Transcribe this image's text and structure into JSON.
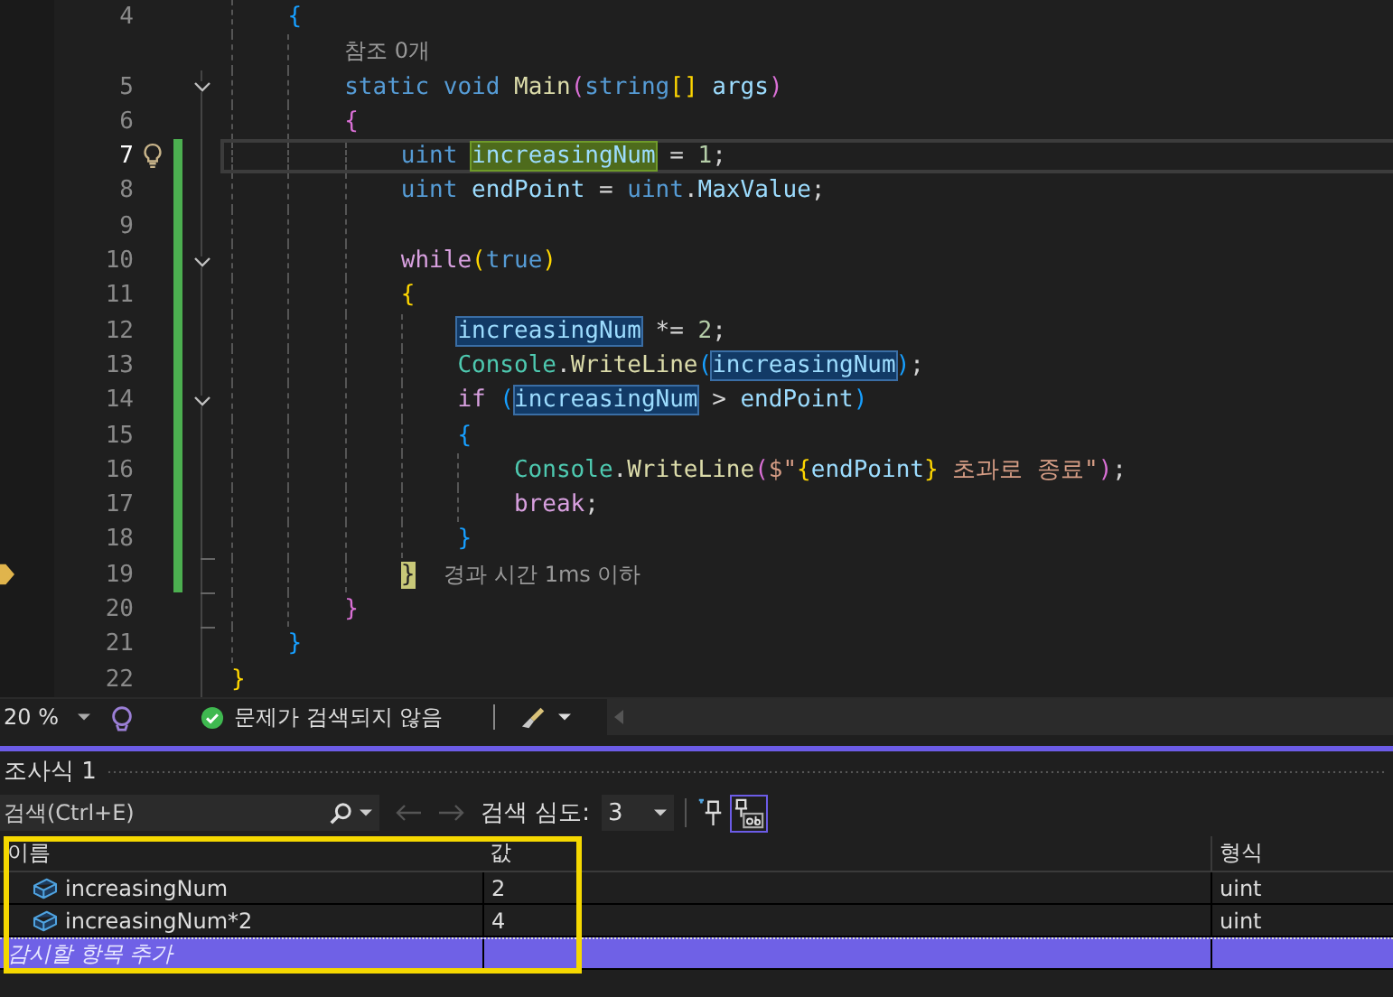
{
  "editor": {
    "lines": [
      {
        "children": [
          {
            "number": "4",
            "selected": false,
            "changed": false,
            "tokens": [
              {
                "text": "{",
                "kind": "brace3"
              }
            ],
            "children": [
              {
                "kind": "lens",
                "text": "참조 0개"
              },
              {
                "number": "5",
                "selected": false,
                "changed": false,
                "collapsible": true,
                "tokens": [
                  {
                    "text": "static ",
                    "kind": "keyword"
                  },
                  {
                    "text": "void ",
                    "kind": "keyword"
                  },
                  {
                    "text": "Main",
                    "kind": "method"
                  },
                  {
                    "text": "(",
                    "kind": "brace2"
                  },
                  {
                    "text": "string",
                    "kind": "keyword"
                  },
                  {
                    "text": "[] ",
                    "kind": "brace1"
                  },
                  {
                    "text": "args",
                    "kind": "variable"
                  },
                  {
                    "text": ")",
                    "kind": "brace2"
                  }
                ]
              },
              {
                "number": "6",
                "selected": false,
                "changed": false,
                "tokens": [
                  {
                    "text": "{",
                    "kind": "brace2"
                  }
                ],
                "children": [
                  {
                    "number": "7",
                    "selected": true,
                    "changed": true,
                    "bulb": true,
                    "tokens": [
                      {
                        "text": "uint ",
                        "kind": "keyword"
                      },
                      {
                        "text": "increasingNum",
                        "kind": "written"
                      },
                      {
                        "text": " = ",
                        "kind": "punct"
                      },
                      {
                        "text": "1",
                        "kind": "number"
                      },
                      {
                        "text": ";",
                        "kind": "punct"
                      }
                    ]
                  },
                  {
                    "number": "8",
                    "selected": false,
                    "changed": true,
                    "tokens": [
                      {
                        "text": "uint ",
                        "kind": "keyword"
                      },
                      {
                        "text": "endPoint",
                        "kind": "variable"
                      },
                      {
                        "text": " = ",
                        "kind": "punct"
                      },
                      {
                        "text": "uint",
                        "kind": "keyword"
                      },
                      {
                        "text": ".",
                        "kind": "punct"
                      },
                      {
                        "text": "MaxValue",
                        "kind": "variable"
                      },
                      {
                        "text": ";",
                        "kind": "punct"
                      }
                    ]
                  },
                  {
                    "number": "9",
                    "selected": false,
                    "changed": true
                  },
                  {
                    "number": "10",
                    "selected": false,
                    "changed": true,
                    "collapsible": true,
                    "tokens": [
                      {
                        "text": "while",
                        "kind": "control"
                      },
                      {
                        "text": "(",
                        "kind": "brace1"
                      },
                      {
                        "text": "true",
                        "kind": "keyword"
                      },
                      {
                        "text": ")",
                        "kind": "brace1"
                      }
                    ]
                  },
                  {
                    "number": "11",
                    "selected": false,
                    "changed": true,
                    "tokens": [
                      {
                        "text": "{",
                        "kind": "brace1"
                      }
                    ],
                    "children": [
                      {
                        "number": "12",
                        "selected": false,
                        "changed": true,
                        "tokens": [
                          {
                            "text": "increasingNum",
                            "kind": "referenced"
                          },
                          {
                            "text": " *= ",
                            "kind": "punct"
                          },
                          {
                            "text": "2",
                            "kind": "number"
                          },
                          {
                            "text": ";",
                            "kind": "punct"
                          }
                        ]
                      },
                      {
                        "number": "13",
                        "selected": false,
                        "changed": true,
                        "tokens": [
                          {
                            "text": "Console",
                            "kind": "class"
                          },
                          {
                            "text": ".",
                            "kind": "punct"
                          },
                          {
                            "text": "WriteLine",
                            "kind": "method"
                          },
                          {
                            "text": "(",
                            "kind": "brace3"
                          },
                          {
                            "text": "increasingNum",
                            "kind": "referenced"
                          },
                          {
                            "text": ")",
                            "kind": "brace3"
                          },
                          {
                            "text": ";",
                            "kind": "punct"
                          }
                        ]
                      },
                      {
                        "number": "14",
                        "selected": false,
                        "changed": true,
                        "collapsible": true,
                        "tokens": [
                          {
                            "text": "if ",
                            "kind": "control"
                          },
                          {
                            "text": "(",
                            "kind": "brace3"
                          },
                          {
                            "text": "increasingNum",
                            "kind": "referenced"
                          },
                          {
                            "text": " > ",
                            "kind": "punct"
                          },
                          {
                            "text": "endPoint",
                            "kind": "variable"
                          },
                          {
                            "text": ")",
                            "kind": "brace3"
                          }
                        ]
                      },
                      {
                        "number": "15",
                        "selected": false,
                        "changed": true,
                        "tokens": [
                          {
                            "text": "{",
                            "kind": "brace3"
                          }
                        ],
                        "children": [
                          {
                            "number": "16",
                            "selected": false,
                            "changed": true,
                            "tokens": [
                              {
                                "text": "Console",
                                "kind": "class"
                              },
                              {
                                "text": ".",
                                "kind": "punct"
                              },
                              {
                                "text": "WriteLine",
                                "kind": "method"
                              },
                              {
                                "text": "(",
                                "kind": "brace2"
                              },
                              {
                                "text": "$\"",
                                "kind": "string"
                              },
                              {
                                "text": "{",
                                "kind": "brace1"
                              },
                              {
                                "text": "endPoint",
                                "kind": "variable"
                              },
                              {
                                "text": "}",
                                "kind": "brace1"
                              },
                              {
                                "text": " 초과로 종료\"",
                                "kind": "string"
                              },
                              {
                                "text": ")",
                                "kind": "brace2"
                              },
                              {
                                "text": ";",
                                "kind": "punct"
                              }
                            ]
                          },
                          {
                            "number": "17",
                            "selected": false,
                            "changed": true,
                            "tokens": [
                              {
                                "text": "break",
                                "kind": "control"
                              },
                              {
                                "text": ";",
                                "kind": "punct"
                              }
                            ]
                          }
                        ]
                      },
                      {
                        "number": "18",
                        "selected": false,
                        "changed": true,
                        "tokens": [
                          {
                            "text": "}",
                            "kind": "brace3"
                          }
                        ]
                      }
                    ]
                  },
                  {
                    "number": "19",
                    "selected": false,
                    "changed": true,
                    "block_end": true,
                    "current_statement": true,
                    "tokens": [
                      {
                        "text": "}",
                        "kind": "matched"
                      }
                    ],
                    "hint": "경과 시간 1ms 이하"
                  }
                ]
              },
              {
                "number": "20",
                "selected": false,
                "changed": false,
                "block_end": true,
                "tokens": [
                  {
                    "text": "}",
                    "kind": "brace2"
                  }
                ]
              }
            ]
          },
          {
            "number": "21",
            "selected": false,
            "changed": false,
            "block_end": true,
            "tokens": [
              {
                "text": "}",
                "kind": "brace3"
              }
            ]
          }
        ]
      },
      {
        "number": "22",
        "selected": false,
        "changed": false,
        "tokens": [
          {
            "text": "}",
            "kind": "brace1"
          }
        ]
      }
    ]
  },
  "status_bar": {
    "zoom": "20 %",
    "issues": "문제가 검색되지 않음"
  },
  "watch": {
    "tab": "조사식 1",
    "search": {
      "placeholder": "검색(Ctrl+E)"
    },
    "depth_label": "검색 심도:",
    "depth_value": "3",
    "ab_toggle": {
      "selected": true
    },
    "columns": [
      "이름",
      "값",
      "형식"
    ],
    "rows": [
      {
        "name": "increasingNum",
        "value": "2",
        "type": "uint",
        "selected": false
      },
      {
        "name": "increasingNum*2",
        "value": "4",
        "type": "uint",
        "selected": false
      }
    ],
    "add_row": {
      "text": "감시할 항목 추가",
      "selected": true
    }
  }
}
